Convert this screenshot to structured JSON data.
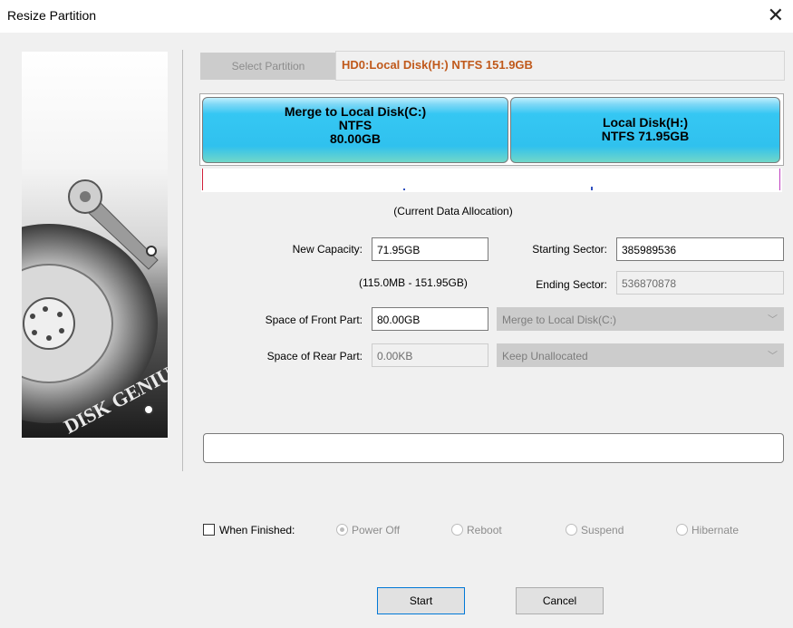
{
  "window": {
    "title": "Resize Partition"
  },
  "header": {
    "select_partition_label": "Select Partition",
    "partition_info": "HD0:Local Disk(H:) NTFS 151.9GB"
  },
  "partitions": [
    {
      "lines": [
        "Merge to Local Disk(C:)",
        "NTFS",
        "80.00GB"
      ]
    },
    {
      "lines": [
        "Local Disk(H:)",
        "NTFS 71.95GB"
      ]
    }
  ],
  "allocation_caption": "(Current Data Allocation)",
  "form": {
    "new_capacity_label": "New Capacity:",
    "new_capacity_value": "71.95GB",
    "range_text": "(115.0MB - 151.95GB)",
    "starting_sector_label": "Starting Sector:",
    "starting_sector_value": "385989536",
    "ending_sector_label": "Ending Sector:",
    "ending_sector_value": "536870878",
    "front_label": "Space of Front Part:",
    "front_value": "80.00GB",
    "front_select": "Merge to Local Disk(C:)",
    "rear_label": "Space of Rear Part:",
    "rear_value": "0.00KB",
    "rear_select": "Keep Unallocated"
  },
  "finish": {
    "checkbox_label": "When Finished:",
    "options": [
      "Power Off",
      "Reboot",
      "Suspend",
      "Hibernate"
    ],
    "selected_index": 0
  },
  "buttons": {
    "start": "Start",
    "cancel": "Cancel"
  },
  "brand_text": "DISK GENIUS",
  "colors": {
    "partition_text": "#c0591b",
    "segment_blue": "#30c1ee",
    "focus_blue": "#0078d7"
  }
}
